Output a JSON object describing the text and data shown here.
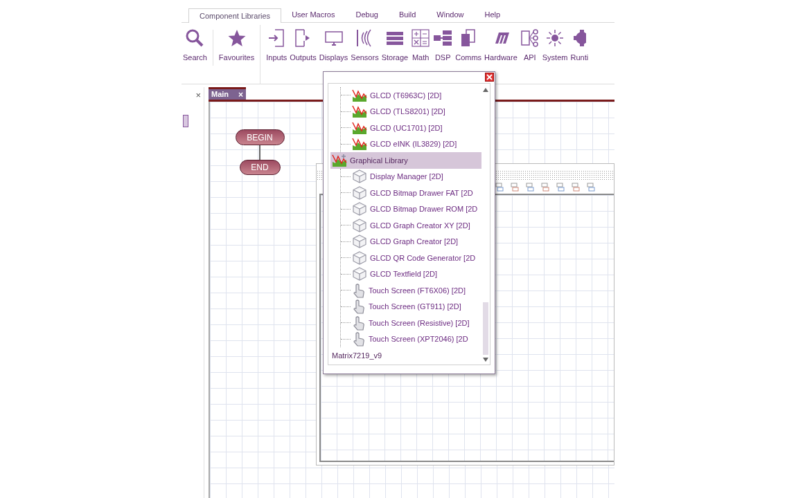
{
  "ribbon_tabs": [
    {
      "label": "Component Libraries",
      "selected": true
    },
    {
      "label": "User Macros",
      "selected": false
    },
    {
      "label": "Debug",
      "selected": false
    },
    {
      "label": "Build",
      "selected": false
    },
    {
      "label": "Window",
      "selected": false
    },
    {
      "label": "Help",
      "selected": false
    }
  ],
  "ribbon_buttons": [
    {
      "label": "Search",
      "kind": "search"
    },
    {
      "label": "Favourites",
      "kind": "star"
    },
    {
      "label": "Inputs",
      "kind": "inputs"
    },
    {
      "label": "Outputs",
      "kind": "outputs"
    },
    {
      "label": "Displays",
      "kind": "displays"
    },
    {
      "label": "Sensors",
      "kind": "sensors"
    },
    {
      "label": "Storage",
      "kind": "storage"
    },
    {
      "label": "Math",
      "kind": "math"
    },
    {
      "label": "DSP",
      "kind": "dsp"
    },
    {
      "label": "Comms",
      "kind": "comms"
    },
    {
      "label": "Hardware",
      "kind": "hardware"
    },
    {
      "label": "API",
      "kind": "api"
    },
    {
      "label": "System",
      "kind": "system"
    },
    {
      "label": "Runti",
      "kind": "runtime"
    }
  ],
  "side_panel": {
    "close": "×"
  },
  "document_tab": {
    "label": "Main",
    "close": "×"
  },
  "flowchart": {
    "begin": "BEGIN",
    "end": "END"
  },
  "component_tree": [
    {
      "children": [
        {
          "label": "GLCD (T6963C) [2D]",
          "kind": "glcd",
          "selected": false
        },
        {
          "label": "GLCD (TLS8201) [2D]",
          "kind": "glcd",
          "selected": false
        },
        {
          "label": "GLCD (UC1701) [2D]",
          "kind": "glcd",
          "selected": false
        },
        {
          "label": "GLCD eINK (IL3829) [2D]",
          "kind": "glcd",
          "selected": false
        }
      ]
    },
    {
      "label": "Graphical Library",
      "kind": "library",
      "selected": true,
      "children": [
        {
          "label": "Display Manager [2D]",
          "kind": "component",
          "selected": false
        },
        {
          "label": "GLCD Bitmap Drawer FAT [2D",
          "kind": "component",
          "selected": false
        },
        {
          "label": "GLCD Bitmap Drawer ROM [2D",
          "kind": "component",
          "selected": false
        },
        {
          "label": "GLCD Graph Creator XY [2D]",
          "kind": "component",
          "selected": false
        },
        {
          "label": "GLCD Graph Creator [2D]",
          "kind": "component",
          "selected": false
        },
        {
          "label": "GLCD QR Code Generator [2D",
          "kind": "component",
          "selected": false
        },
        {
          "label": "GLCD Textfield [2D]",
          "kind": "component",
          "selected": false
        },
        {
          "label": "Touch Screen (FT6X06) [2D]",
          "kind": "touch",
          "selected": false
        },
        {
          "label": "Touch Screen (GT911) [2D]",
          "kind": "touch",
          "selected": false
        },
        {
          "label": "Touch Screen (Resistive) [2D]",
          "kind": "touch",
          "selected": false
        },
        {
          "label": "Touch Screen (XPT2046) [2D",
          "kind": "touch",
          "selected": false
        }
      ]
    },
    {
      "label": "Matrix7219_v9",
      "kind": "plain",
      "selected": false
    }
  ]
}
